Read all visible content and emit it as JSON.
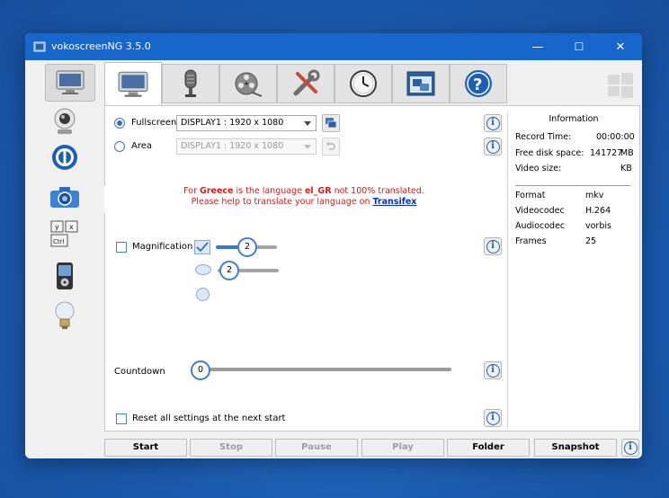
{
  "window": {
    "title": "vokoscreenNG 3.5.0",
    "controls": {
      "minimize": "—",
      "maximize": "☐",
      "close": "✕"
    }
  },
  "sidebar": {
    "items": [
      {
        "name": "screencast",
        "icon": "monitor-icon"
      },
      {
        "name": "camera",
        "icon": "webcam-icon"
      },
      {
        "name": "player",
        "icon": "power-ring-icon"
      },
      {
        "name": "snapshot",
        "icon": "photo-camera-icon"
      },
      {
        "name": "showkey",
        "icon": "keyboard-keys-icon"
      },
      {
        "name": "player2",
        "icon": "media-player-icon"
      },
      {
        "name": "tips",
        "icon": "lightbulb-icon"
      }
    ]
  },
  "tabs": [
    {
      "name": "screen",
      "icon": "monitor-icon"
    },
    {
      "name": "audio",
      "icon": "microphone-icon"
    },
    {
      "name": "video",
      "icon": "film-reel-icon"
    },
    {
      "name": "misc",
      "icon": "tools-icon"
    },
    {
      "name": "timer",
      "icon": "clock-icon"
    },
    {
      "name": "windows",
      "icon": "windows-icon"
    },
    {
      "name": "about",
      "icon": "help-icon"
    }
  ],
  "screen": {
    "fullscreen_label": "Fullscreen",
    "fullscreen_display": "DISPLAY1 :  1920 x 1080",
    "area_label": "Area",
    "area_display": "DISPLAY1 :  1920 x 1080",
    "magnification_label": "Magnification",
    "magnification_value_1": "2",
    "magnification_value_2": "2",
    "countdown_label": "Countdown",
    "countdown_value": "0",
    "reset_label": "Reset all settings at the next start"
  },
  "notice": {
    "line1_pre": "For ",
    "line1_country": "Greece",
    "line1_mid": " is the language ",
    "line1_lang": "el_GR",
    "line1_post": " not 100% translated.",
    "line2_pre": "Please help to translate your language on ",
    "line2_link": "Transifex"
  },
  "info": {
    "title": "Information",
    "record_time_label": "Record Time:",
    "record_time_value": "00:00:00",
    "free_disk_label": "Free disk space:",
    "free_disk_value": "141727",
    "free_disk_unit": "MB",
    "video_size_label": "Video size:",
    "video_size_unit": "KB",
    "format_label": "Format",
    "format_value": "mkv",
    "videocodec_label": "Videocodec",
    "videocodec_value": "H.264",
    "audiocodec_label": "Audiocodec",
    "audiocodec_value": "vorbis",
    "frames_label": "Frames",
    "frames_value": "25"
  },
  "bottom": {
    "start": "Start",
    "stop": "Stop",
    "pause": "Pause",
    "play": "Play",
    "folder": "Folder",
    "snapshot": "Snapshot"
  },
  "colors": {
    "titlebar": "#1766cc",
    "accent": "#3e7fd2",
    "notice_red": "#d41d1d",
    "link_blue": "#0a2db8"
  }
}
